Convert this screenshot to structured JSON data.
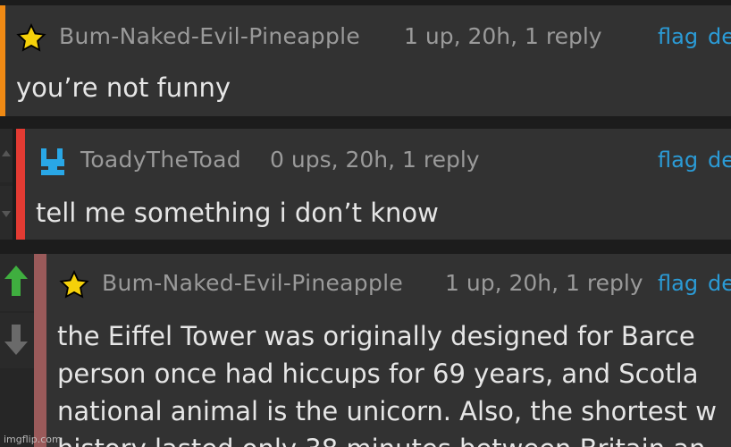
{
  "colors": {
    "background": "#1c1c1c",
    "card": "#323232",
    "meta_text": "#9a9a9a",
    "body_text": "#e6e6e6",
    "link": "#2b9bd6",
    "bar_orange": "#f08a14",
    "bar_red": "#e33b33",
    "bar_muted": "#9a5a5a",
    "upvote_green": "#3fae3f",
    "star": "#f5d10a"
  },
  "comments": [
    {
      "username": "Bum-Naked-Evil-Pineapple",
      "meta": "1 up, 20h, 1 reply",
      "flag": "flag",
      "del": "de",
      "text": [
        "you’re not funny"
      ],
      "icon": "star-icon"
    },
    {
      "username": "ToadyTheToad",
      "meta": "0 ups, 20h, 1 reply",
      "flag": "flag",
      "del": "de",
      "text": [
        "tell me something i don’t know"
      ],
      "icon": "toad-avatar-icon"
    },
    {
      "username": "Bum-Naked-Evil-Pineapple",
      "meta": "1 up, 20h, 1 reply",
      "flag": "flag",
      "del": "de",
      "text": [
        "the Eiffel Tower was originally designed for Barce",
        "person once had hiccups for 69 years, and Scotla",
        "national animal is the unicorn. Also, the shortest w",
        "history lasted only 38 minutes between Britain an"
      ],
      "icon": "star-icon"
    }
  ],
  "vote_state": {
    "upvoted": true
  },
  "watermark": "imgflip.com"
}
